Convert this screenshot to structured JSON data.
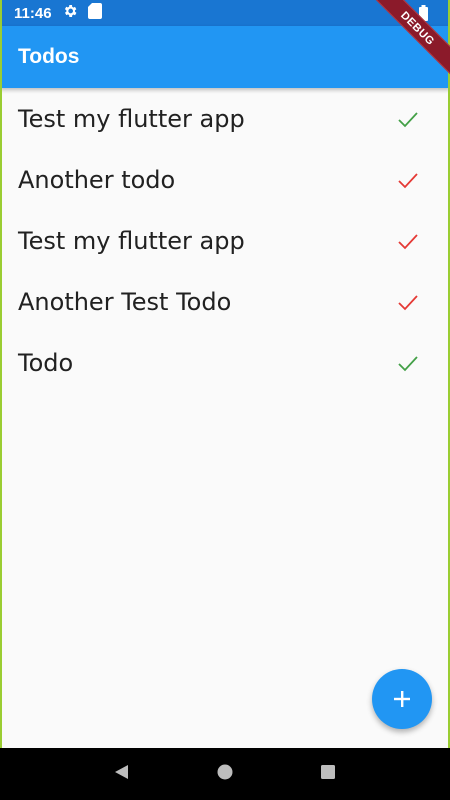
{
  "status_bar": {
    "time": "11:46",
    "icons": [
      "gear-icon",
      "sd-card-icon",
      "wifi-icon",
      "battery-icon"
    ]
  },
  "debug_banner": "DEBUG",
  "app_bar": {
    "title": "Todos"
  },
  "todos": [
    {
      "text": "Test my flutter app",
      "done": true
    },
    {
      "text": "Another todo",
      "done": false
    },
    {
      "text": "Test my flutter app",
      "done": false
    },
    {
      "text": "Another Test Todo",
      "done": false
    },
    {
      "text": "Todo",
      "done": true
    }
  ],
  "colors": {
    "primary": "#2196f3",
    "primary_dark": "#1976d2",
    "done_check": "#43a047",
    "undone_check": "#e53935"
  },
  "fab": {
    "icon": "plus-icon"
  },
  "nav_bar": {
    "icons": [
      "back-icon",
      "home-icon",
      "recents-icon"
    ]
  }
}
